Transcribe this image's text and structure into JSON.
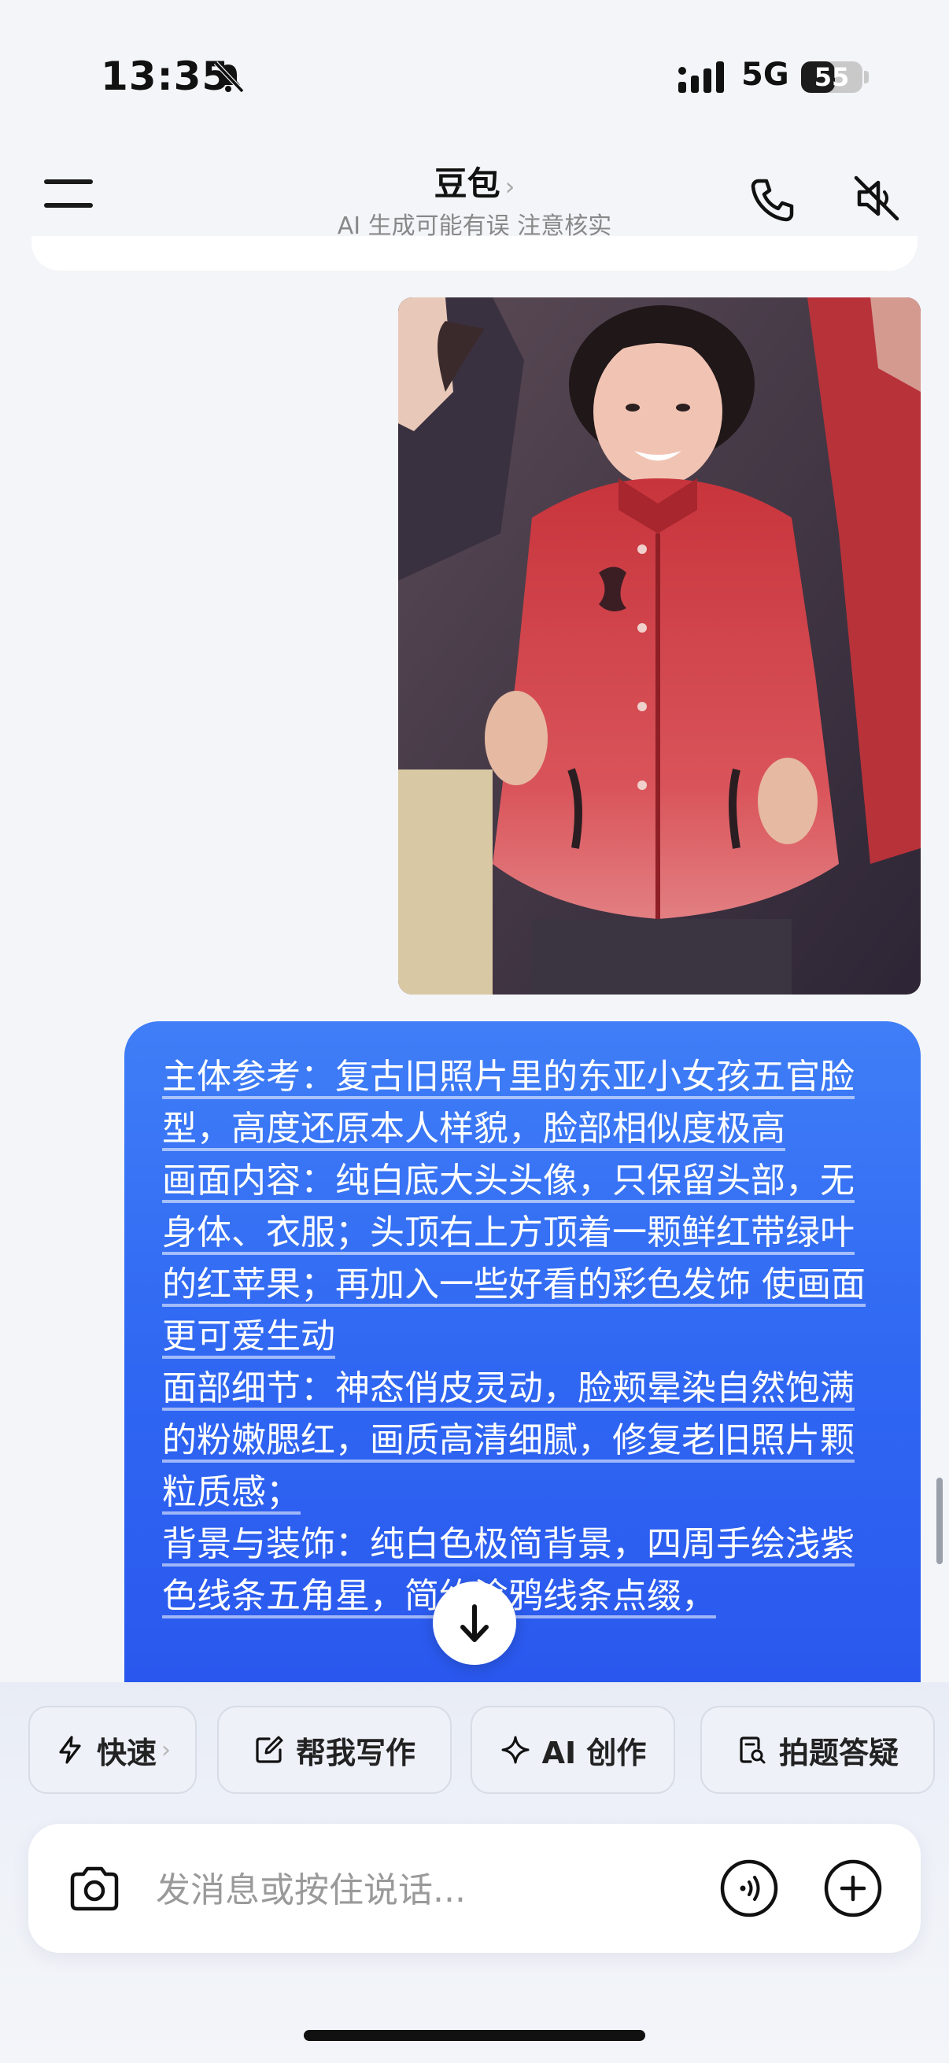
{
  "status_bar": {
    "time": "13:35",
    "network": "5G",
    "battery_level": "55",
    "battery_fraction": 0.55,
    "icons": [
      "bell-muted-icon",
      "signal-icon",
      "battery-icon"
    ]
  },
  "header": {
    "title": "豆包",
    "title_chevron": "›",
    "subtitle": "AI 生成可能有误 注意核实",
    "icons": [
      "menu-icon",
      "phone-icon",
      "speaker-muted-icon"
    ]
  },
  "chat": {
    "user_photo_icon": "photo-thumbnail",
    "user_message": "主体参考：复古旧照片里的东亚小女孩五官脸型，高度还原本人样貌，脸部相似度极高\n画面内容：纯白底大头头像，只保留头部，无身体、衣服；头顶右上方顶着一颗鲜红带绿叶的红苹果；再加入一些好看的彩色发饰 使画面更可爱生动\n面部细节：神态俏皮灵动，脸颊晕染自然饱满的粉嫩腮红，画质高清细腻，修复老旧照片颗粒质感；\n背景与装饰：纯白色极简背景，四周手绘浅紫色线条五角星，简约涂鸦线条点缀，",
    "scroll_down_icon": "arrow-down-icon"
  },
  "shortcuts": [
    {
      "label": "快速",
      "icon": "lightning-icon",
      "chevron": "›"
    },
    {
      "label": "帮我写作",
      "icon": "edit-icon"
    },
    {
      "label": "AI 创作",
      "icon": "sparkle-icon"
    },
    {
      "label": "拍题答疑",
      "icon": "scan-doc-icon"
    }
  ],
  "input": {
    "placeholder": "发消息或按住说话...",
    "icons": [
      "camera-icon",
      "voice-icon",
      "plus-icon"
    ]
  },
  "colors": {
    "bubble": "#3a74f5",
    "background": "#f4f5f8",
    "text_primary": "#111111"
  }
}
